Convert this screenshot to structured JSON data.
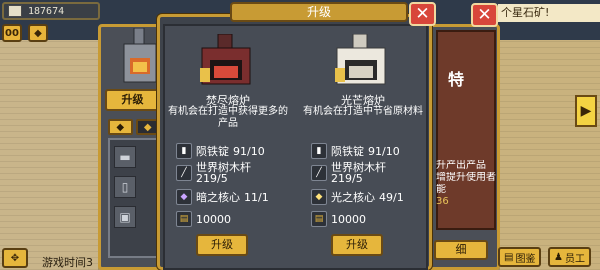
{
  "hud": {
    "coins": "187674",
    "top_message": "个星石矿!",
    "game_time": "游戏时间3",
    "btn_pause": "00",
    "btn_tools": "◆"
  },
  "back_panel": {
    "upgrade_label": "升级",
    "right_title": "特",
    "right_lines": [
      "升产出产品",
      "增提升使用者",
      "能"
    ],
    "right_number": "36",
    "right_button": "细",
    "bottom_buttons": [
      "图鉴",
      "员工"
    ]
  },
  "modal": {
    "title": "升级",
    "close_icon": "close-icon",
    "options": [
      {
        "name": "焚尽熔炉",
        "description": "有机会在打造中获得更多的产品",
        "furnace_color": "#8b3a3a",
        "materials": [
          {
            "icon": "ingot-icon",
            "label": "陨铁锭",
            "amount": "91/10"
          },
          {
            "icon": "wood-icon",
            "label": "世界树木杆",
            "amount": "219/5"
          },
          {
            "icon": "dark-core-icon",
            "label": "暗之核心",
            "amount": "11/1"
          },
          {
            "icon": "coin-icon",
            "label": "",
            "amount": "10000"
          }
        ],
        "button_label": "升级"
      },
      {
        "name": "光芒熔炉",
        "description": "有机会在打造中节省原材料",
        "furnace_color": "#e9e6dc",
        "materials": [
          {
            "icon": "ingot-icon",
            "label": "陨铁锭",
            "amount": "91/10"
          },
          {
            "icon": "wood-icon",
            "label": "世界树木杆",
            "amount": "219/5"
          },
          {
            "icon": "light-core-icon",
            "label": "光之核心",
            "amount": "49/1"
          },
          {
            "icon": "coin-icon",
            "label": "",
            "amount": "10000"
          }
        ],
        "button_label": "升级"
      }
    ]
  }
}
